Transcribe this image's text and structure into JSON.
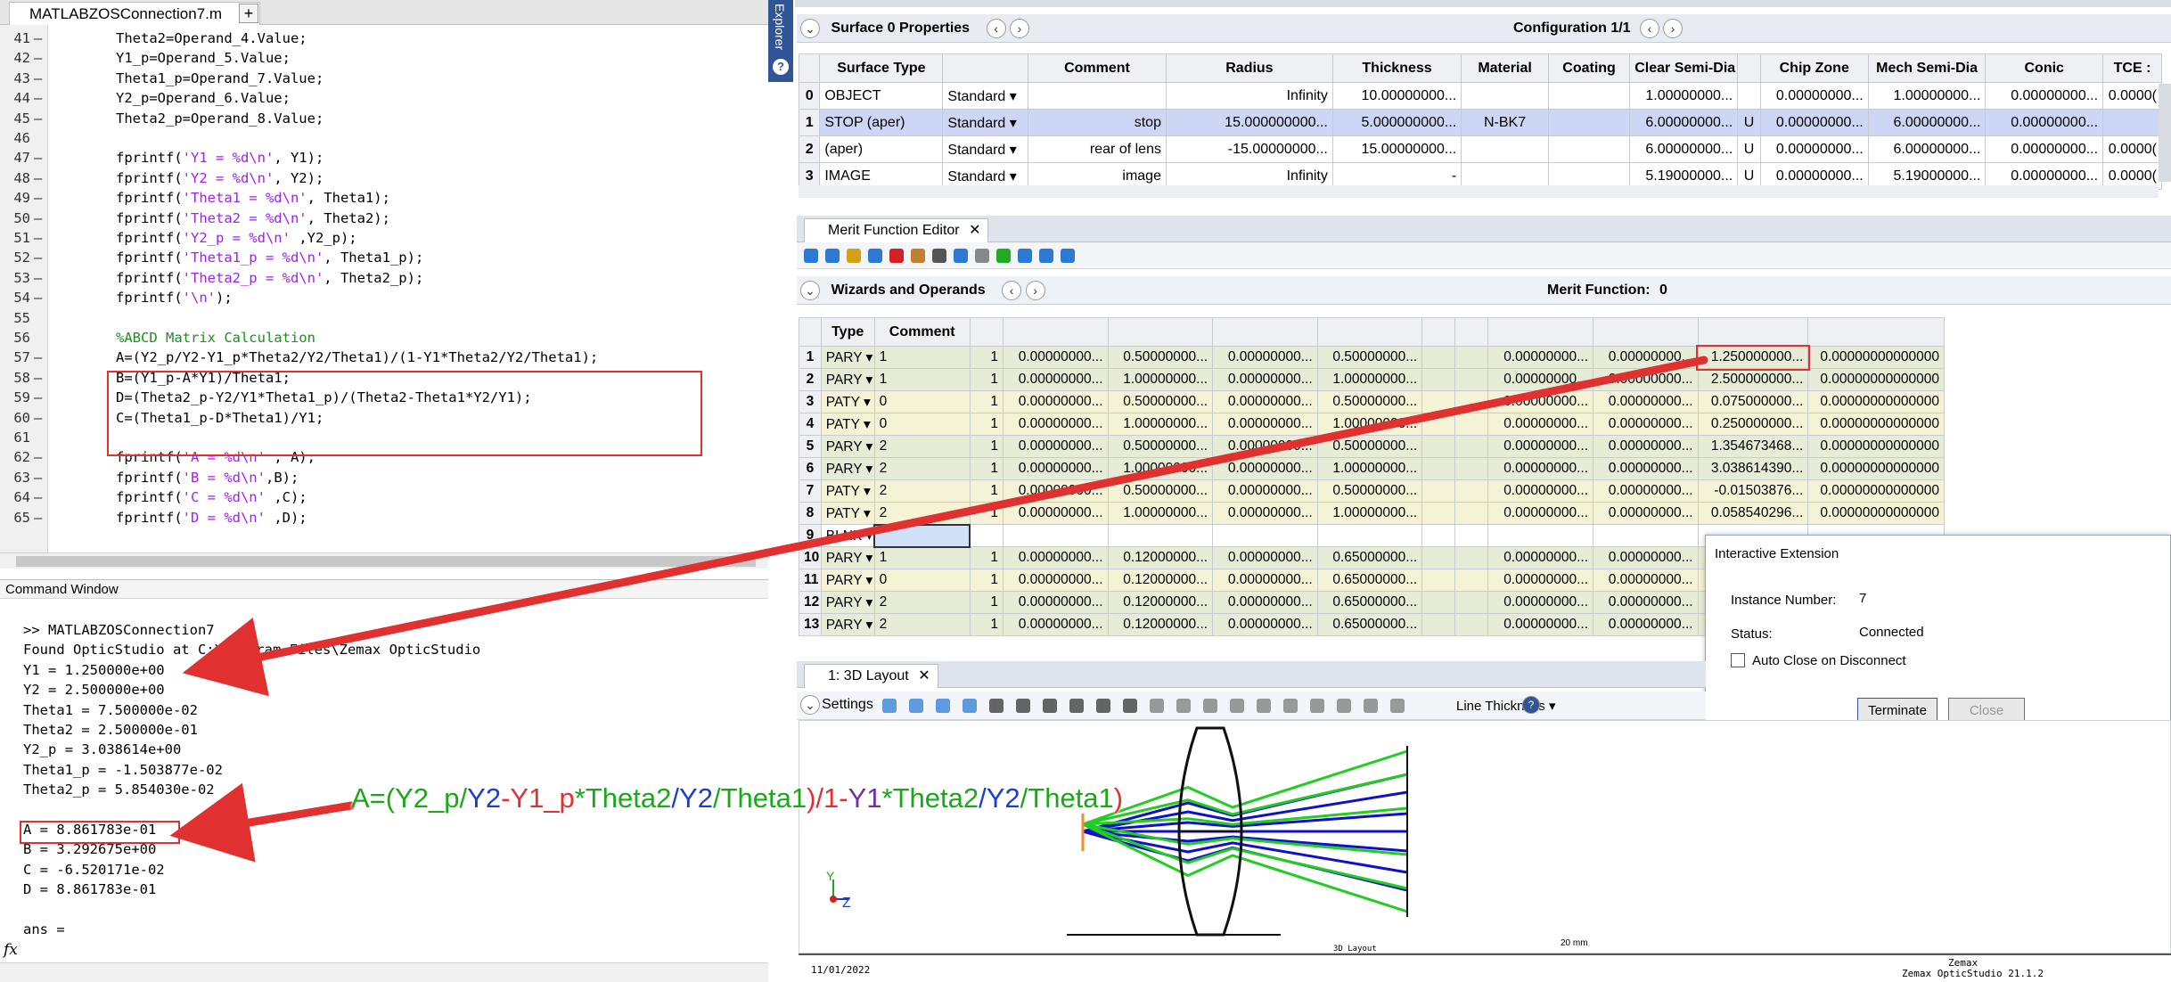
{
  "editor": {
    "file_tab": "MATLABZOSConnection7.m",
    "close_glyph": "×",
    "add_glyph": "+",
    "lines": [
      {
        "n": "41",
        "dash": "–",
        "parts": [
          {
            "t": "Theta2=Operand_4.Value;",
            "c": ""
          }
        ]
      },
      {
        "n": "42",
        "dash": "–",
        "parts": [
          {
            "t": "Y1_p=Operand_5.Value;",
            "c": ""
          }
        ]
      },
      {
        "n": "43",
        "dash": "–",
        "parts": [
          {
            "t": "Theta1_p=Operand_7.Value;",
            "c": ""
          }
        ]
      },
      {
        "n": "44",
        "dash": "–",
        "parts": [
          {
            "t": "Y2_p=Operand_6.Value;",
            "c": ""
          }
        ]
      },
      {
        "n": "45",
        "dash": "–",
        "parts": [
          {
            "t": "Theta2_p=Operand_8.Value;",
            "c": ""
          }
        ]
      },
      {
        "n": "46",
        "dash": "",
        "parts": []
      },
      {
        "n": "47",
        "dash": "–",
        "parts": [
          {
            "t": "fprintf(",
            "c": ""
          },
          {
            "t": "'Y1 = %d\\n'",
            "c": "str"
          },
          {
            "t": ", Y1);",
            "c": ""
          }
        ]
      },
      {
        "n": "48",
        "dash": "–",
        "parts": [
          {
            "t": "fprintf(",
            "c": ""
          },
          {
            "t": "'Y2 = %d\\n'",
            "c": "str"
          },
          {
            "t": ", Y2);",
            "c": ""
          }
        ]
      },
      {
        "n": "49",
        "dash": "–",
        "parts": [
          {
            "t": "fprintf(",
            "c": ""
          },
          {
            "t": "'Theta1 = %d\\n'",
            "c": "str"
          },
          {
            "t": ", Theta1);",
            "c": ""
          }
        ]
      },
      {
        "n": "50",
        "dash": "–",
        "parts": [
          {
            "t": "fprintf(",
            "c": ""
          },
          {
            "t": "'Theta2 = %d\\n'",
            "c": "str"
          },
          {
            "t": ", Theta2);",
            "c": ""
          }
        ]
      },
      {
        "n": "51",
        "dash": "–",
        "parts": [
          {
            "t": "fprintf(",
            "c": ""
          },
          {
            "t": "'Y2_p = %d\\n'",
            "c": "str"
          },
          {
            "t": " ,Y2_p);",
            "c": ""
          }
        ]
      },
      {
        "n": "52",
        "dash": "–",
        "parts": [
          {
            "t": "fprintf(",
            "c": ""
          },
          {
            "t": "'Theta1_p = %d\\n'",
            "c": "str"
          },
          {
            "t": ", Theta1_p);",
            "c": ""
          }
        ]
      },
      {
        "n": "53",
        "dash": "–",
        "parts": [
          {
            "t": "fprintf(",
            "c": ""
          },
          {
            "t": "'Theta2_p = %d\\n'",
            "c": "str"
          },
          {
            "t": ", Theta2_p);",
            "c": ""
          }
        ]
      },
      {
        "n": "54",
        "dash": "–",
        "parts": [
          {
            "t": "fprintf(",
            "c": ""
          },
          {
            "t": "'\\n'",
            "c": "str"
          },
          {
            "t": ");",
            "c": ""
          }
        ]
      },
      {
        "n": "55",
        "dash": "",
        "parts": []
      },
      {
        "n": "56",
        "dash": "",
        "parts": [
          {
            "t": "%ABCD Matrix Calculation",
            "c": "cmt"
          }
        ]
      },
      {
        "n": "57",
        "dash": "–",
        "parts": [
          {
            "t": "A=(Y2_p/Y2-Y1_p*Theta2/Y2/Theta1)/(1-Y1*Theta2/Y2/Theta1);",
            "c": ""
          }
        ]
      },
      {
        "n": "58",
        "dash": "–",
        "parts": [
          {
            "t": "B=(Y1_p-A*Y1)/Theta1;",
            "c": ""
          }
        ]
      },
      {
        "n": "59",
        "dash": "–",
        "parts": [
          {
            "t": "D=(Theta2_p-Y2/Y1*Theta1_p)/(Theta2-Theta1*Y2/Y1);",
            "c": ""
          }
        ]
      },
      {
        "n": "60",
        "dash": "–",
        "parts": [
          {
            "t": "C=(Theta1_p-D*Theta1)/Y1;",
            "c": ""
          }
        ]
      },
      {
        "n": "61",
        "dash": "",
        "parts": []
      },
      {
        "n": "62",
        "dash": "–",
        "parts": [
          {
            "t": "fprintf(",
            "c": ""
          },
          {
            "t": "'A = %d\\n'",
            "c": "str"
          },
          {
            "t": " , A);",
            "c": ""
          }
        ]
      },
      {
        "n": "63",
        "dash": "–",
        "parts": [
          {
            "t": "fprintf(",
            "c": ""
          },
          {
            "t": "'B = %d\\n'",
            "c": "str"
          },
          {
            "t": ",B);",
            "c": ""
          }
        ]
      },
      {
        "n": "64",
        "dash": "–",
        "parts": [
          {
            "t": "fprintf(",
            "c": ""
          },
          {
            "t": "'C = %d\\n'",
            "c": "str"
          },
          {
            "t": " ,C);",
            "c": ""
          }
        ]
      },
      {
        "n": "65",
        "dash": "–",
        "parts": [
          {
            "t": "fprintf(",
            "c": ""
          },
          {
            "t": "'D = %d\\n'",
            "c": "str"
          },
          {
            "t": " ,D);",
            "c": ""
          }
        ]
      }
    ]
  },
  "command_window": {
    "title": "Command Window",
    "fx": "fx",
    "lines": [
      ">> MATLABZOSConnection7",
      "Found OpticStudio at C:\\Program Files\\Zemax OpticStudio",
      "Y1 = 1.250000e+00",
      "Y2 = 2.500000e+00",
      "Theta1 = 7.500000e-02",
      "Theta2 = 2.500000e-01",
      "Y2_p = 3.038614e+00",
      "Theta1_p = -1.503877e-02",
      "Theta2_p = 5.854030e-02",
      "",
      "A = 8.861783e-01",
      "B = 3.292675e+00",
      "C = -6.520171e-02",
      "D = 8.861783e-01",
      "",
      "ans ="
    ]
  },
  "explorer": {
    "label": "Explorer",
    "help": "?"
  },
  "lde": {
    "header_left": "Surface  0 Properties",
    "header_right": "Configuration 1/1",
    "nav_prev": "‹",
    "nav_next": "›",
    "columns": [
      "",
      "Surface Type",
      "",
      "Comment",
      "Radius",
      "Thickness",
      "Material",
      "Coating",
      "Clear Semi-Dia",
      "",
      "Chip Zone",
      "Mech Semi-Dia",
      "Conic",
      "TCE :"
    ],
    "rows": [
      [
        "0",
        "OBJECT",
        "Standard ▾",
        "",
        "Infinity",
        "10.00000000...",
        "",
        "",
        "1.00000000...",
        "",
        "0.00000000...",
        "1.00000000...",
        "0.00000000...",
        "0.0000("
      ],
      [
        "1",
        "STOP (aper)",
        "Standard ▾",
        "stop",
        "15.000000000...",
        "5.000000000...",
        "N-BK7",
        "",
        "6.00000000...",
        "U",
        "0.00000000...",
        "6.00000000...",
        "0.00000000...",
        ""
      ],
      [
        "2",
        "(aper)",
        "Standard ▾",
        "rear of lens",
        "-15.00000000...",
        "15.00000000...",
        "",
        "",
        "6.00000000...",
        "U",
        "0.00000000...",
        "6.00000000...",
        "0.00000000...",
        "0.0000("
      ],
      [
        "3",
        "IMAGE",
        "Standard ▾",
        "image",
        "Infinity",
        "-",
        "",
        "",
        "5.19000000...",
        "U",
        "0.00000000...",
        "5.19000000...",
        "0.00000000...",
        "0.0000("
      ]
    ]
  },
  "mfe": {
    "tab_title": "Merit Function Editor",
    "close_glyph": "✕",
    "wizards_label": "Wizards and Operands",
    "merit_label": "Merit Function:",
    "merit_value": "0",
    "columns": [
      "",
      "Type",
      "Comment",
      "",
      "",
      "",
      "",
      "",
      "",
      "",
      "",
      "",
      "",
      "",
      ""
    ],
    "rows": [
      {
        "cls": "g",
        "c": [
          "1",
          "PARY ▾",
          "1",
          "1",
          "0.00000000...",
          "0.50000000...",
          "0.00000000...",
          "0.50000000...",
          "",
          "",
          "0.00000000...",
          "0.00000000...",
          "1.250000000...",
          "0.00000000000000"
        ]
      },
      {
        "cls": "g",
        "c": [
          "2",
          "PARY ▾",
          "1",
          "1",
          "0.00000000...",
          "1.00000000...",
          "0.00000000...",
          "1.00000000...",
          "",
          "",
          "0.00000000...",
          "0.00000000...",
          "2.500000000...",
          "0.00000000000000"
        ]
      },
      {
        "cls": "y",
        "c": [
          "3",
          "PATY ▾",
          "0",
          "1",
          "0.00000000...",
          "0.50000000...",
          "0.00000000...",
          "0.50000000...",
          "",
          "",
          "0.00000000...",
          "0.00000000...",
          "0.075000000...",
          "0.00000000000000"
        ]
      },
      {
        "cls": "y",
        "c": [
          "4",
          "PATY ▾",
          "0",
          "1",
          "0.00000000...",
          "1.00000000...",
          "0.00000000...",
          "1.00000000...",
          "",
          "",
          "0.00000000...",
          "0.00000000...",
          "0.250000000...",
          "0.00000000000000"
        ]
      },
      {
        "cls": "g",
        "c": [
          "5",
          "PARY ▾",
          "2",
          "1",
          "0.00000000...",
          "0.50000000...",
          "0.00000000...",
          "0.50000000...",
          "",
          "",
          "0.00000000...",
          "0.00000000...",
          "1.354673468...",
          "0.00000000000000"
        ]
      },
      {
        "cls": "g",
        "c": [
          "6",
          "PARY ▾",
          "2",
          "1",
          "0.00000000...",
          "1.00000000...",
          "0.00000000...",
          "1.00000000...",
          "",
          "",
          "0.00000000...",
          "0.00000000...",
          "3.038614390...",
          "0.00000000000000"
        ]
      },
      {
        "cls": "y",
        "c": [
          "7",
          "PATY ▾",
          "2",
          "1",
          "0.00000000...",
          "0.50000000...",
          "0.00000000...",
          "0.50000000...",
          "",
          "",
          "0.00000000...",
          "0.00000000...",
          "-0.01503876...",
          "0.00000000000000"
        ]
      },
      {
        "cls": "y",
        "c": [
          "8",
          "PATY ▾",
          "2",
          "1",
          "0.00000000...",
          "1.00000000...",
          "0.00000000...",
          "1.00000000...",
          "",
          "",
          "0.00000000...",
          "0.00000000...",
          "0.058540296...",
          "0.00000000000000"
        ]
      },
      {
        "cls": "blnk",
        "c": [
          "9",
          "BLNK ▾",
          "",
          "",
          "",
          "",
          "",
          "",
          "",
          "",
          "",
          "",
          "",
          ""
        ]
      },
      {
        "cls": "g",
        "c": [
          "10",
          "PARY ▾",
          "1",
          "1",
          "0.00000000...",
          "0.12000000...",
          "0.00000000...",
          "0.65000000...",
          "",
          "",
          "0.00000000...",
          "0.00000000...",
          "",
          ""
        ]
      },
      {
        "cls": "y",
        "c": [
          "11",
          "PARY ▾",
          "0",
          "1",
          "0.00000000...",
          "0.12000000...",
          "0.00000000...",
          "0.65000000...",
          "",
          "",
          "0.00000000...",
          "0.00000000...",
          "",
          ""
        ]
      },
      {
        "cls": "g",
        "c": [
          "12",
          "PARY ▾",
          "2",
          "1",
          "0.00000000...",
          "0.12000000...",
          "0.00000000...",
          "0.65000000...",
          "",
          "",
          "0.00000000...",
          "0.00000000...",
          "",
          ""
        ]
      },
      {
        "cls": "g",
        "c": [
          "13",
          "PARY ▾",
          "2",
          "1",
          "0.00000000...",
          "0.12000000...",
          "0.00000000...",
          "0.65000000...",
          "",
          "",
          "0.00000000...",
          "0.00000000...",
          "",
          ""
        ]
      }
    ]
  },
  "interactive_extension": {
    "title": "Interactive Extension",
    "instance_label": "Instance Number:",
    "instance_value": "7",
    "status_label": "Status:",
    "status_value": "Connected",
    "auto_close_label": "Auto Close on Disconnect",
    "terminate_label": "Terminate",
    "close_label": "Close"
  },
  "layout": {
    "tab_title": "1: 3D Layout",
    "close_glyph": "✕",
    "settings_label": "Settings",
    "line_thickness_label": "Line Thickness ▾",
    "axis_y": "Y",
    "axis_z": "Z",
    "scale_label": "20 mm",
    "caption": "3D Layout",
    "footer_date": "11/01/2022",
    "footer_brand": "Zemax",
    "footer_product": "Zemax OpticStudio 21.1.2"
  },
  "annotation": {
    "formula_parts": [
      {
        "t": "A=(",
        "c": "#1aa81a"
      },
      {
        "t": "Y2_p",
        "c": "#1aa81a"
      },
      {
        "t": "/",
        "c": "#1aa81a"
      },
      {
        "t": "Y2",
        "c": "#1a3cd8"
      },
      {
        "t": "-",
        "c": "#e03030"
      },
      {
        "t": "Y1_p",
        "c": "#e03030"
      },
      {
        "t": "*",
        "c": "#1aa81a"
      },
      {
        "t": "Theta2",
        "c": "#1aa81a"
      },
      {
        "t": "/",
        "c": "#1a3cd8"
      },
      {
        "t": "Y2",
        "c": "#1a3cd8"
      },
      {
        "t": "/",
        "c": "#1aa81a"
      },
      {
        "t": "Theta1",
        "c": "#1aa81a"
      },
      {
        "t": ")/",
        "c": "#e03030"
      },
      {
        "t": "1-",
        "c": "#e03030"
      },
      {
        "t": "Y1",
        "c": "#7030a0"
      },
      {
        "t": "*",
        "c": "#1aa81a"
      },
      {
        "t": "Theta2",
        "c": "#1aa81a"
      },
      {
        "t": "/",
        "c": "#1a3cd8"
      },
      {
        "t": "Y2",
        "c": "#1a3cd8"
      },
      {
        "t": "/",
        "c": "#1aa81a"
      },
      {
        "t": "Theta1",
        "c": "#1aa81a"
      },
      {
        "t": ")",
        "c": "#e03030"
      }
    ]
  },
  "colors": {
    "annotation_red": "#e03030",
    "ray_green": "#22cc22",
    "ray_blue": "#1010c8",
    "selected_row": "#cdd6f5"
  }
}
